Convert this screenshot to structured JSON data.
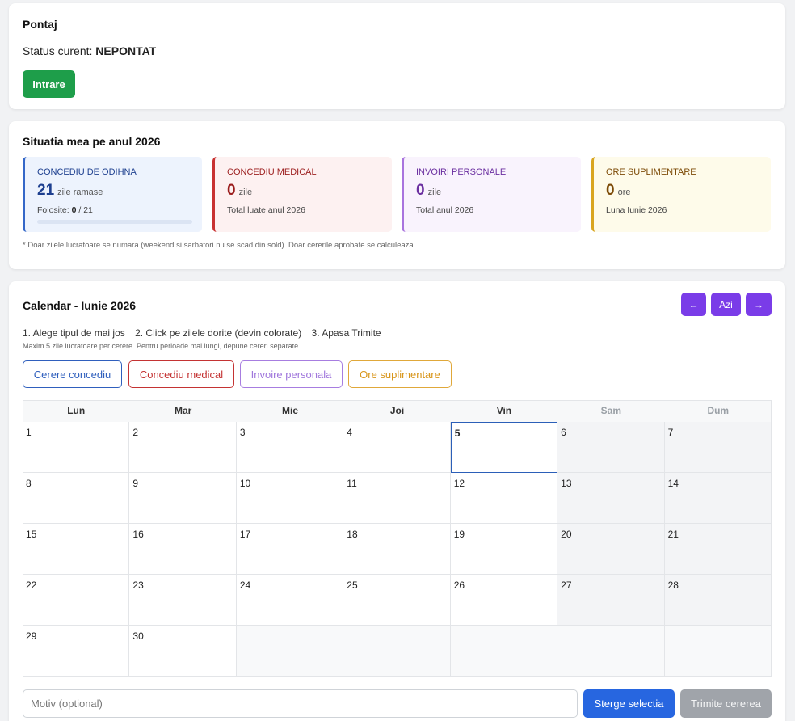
{
  "pontaj": {
    "title": "Pontaj",
    "status_label": "Status curent:",
    "status_value": "NEPONTAT",
    "entry_button": "Intrare"
  },
  "situatia": {
    "title": "Situatia mea pe anul 2026",
    "cards": [
      {
        "title": "CONCEDIU DE ODIHNA",
        "value": "21",
        "unit": "zile ramase",
        "sub_label": "Folosite:",
        "sub_used": "0",
        "sub_total": "/ 21",
        "progress_fraction": 0
      },
      {
        "title": "CONCEDIU MEDICAL",
        "value": "0",
        "unit": "zile",
        "sub": "Total luate anul 2026"
      },
      {
        "title": "INVOIRI PERSONALE",
        "value": "0",
        "unit": "zile",
        "sub": "Total anul 2026"
      },
      {
        "title": "ORE SUPLIMENTARE",
        "value": "0",
        "unit": "ore",
        "sub": "Luna Iunie 2026"
      }
    ],
    "note": "* Doar zilele lucratoare se numara (weekend si sarbatori nu se scad din sold). Doar cererile aprobate se calculeaza."
  },
  "calendar": {
    "title": "Calendar - Iunie 2026",
    "prev_label": "←",
    "today_label": "Azi",
    "next_label": "→",
    "steps": [
      "1. Alege tipul de mai jos",
      "2. Click pe zilele dorite (devin colorate)",
      "3. Apasa Trimite"
    ],
    "hint": "Maxim 5 zile lucratoare per cerere. Pentru perioade mai lungi, depune cereri separate.",
    "types": [
      "Cerere concediu",
      "Concediu medical",
      "Invoire personala",
      "Ore suplimentare"
    ],
    "weekdays": [
      "Lun",
      "Mar",
      "Mie",
      "Joi",
      "Vin",
      "Sam",
      "Dum"
    ],
    "weeks": [
      [
        "1",
        "2",
        "3",
        "4",
        "5",
        "6",
        "7"
      ],
      [
        "8",
        "9",
        "10",
        "11",
        "12",
        "13",
        "14"
      ],
      [
        "15",
        "16",
        "17",
        "18",
        "19",
        "20",
        "21"
      ],
      [
        "22",
        "23",
        "24",
        "25",
        "26",
        "27",
        "28"
      ],
      [
        "29",
        "30",
        "",
        "",
        "",
        "",
        ""
      ]
    ],
    "today": "5",
    "motiv_placeholder": "Motiv (optional)",
    "clear_button": "Sterge selectia",
    "submit_button": "Trimite cererea"
  }
}
